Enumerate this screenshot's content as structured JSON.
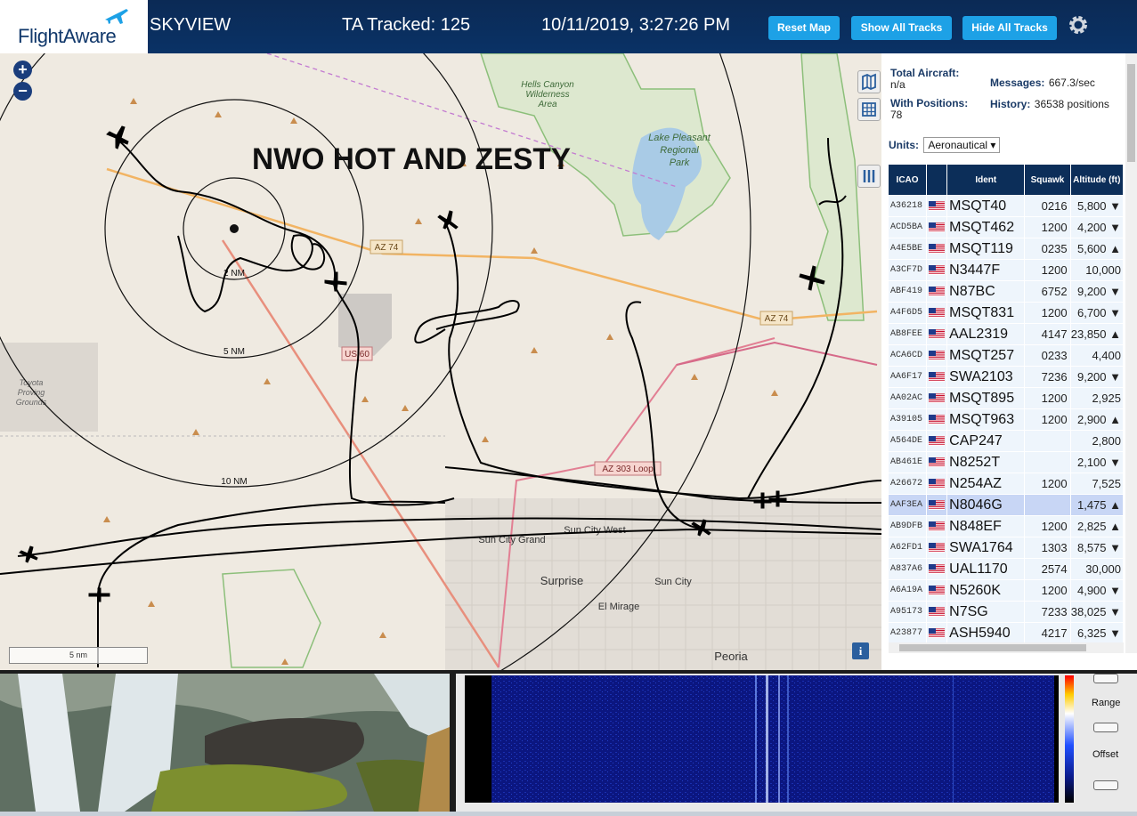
{
  "header": {
    "logo_text": "FlightAware",
    "app_name": "SKYVIEW",
    "tracked": "TA Tracked: 125",
    "datetime": "10/11/2019, 3:27:26 PM",
    "buttons": {
      "reset": "Reset Map",
      "show_all": "Show All Tracks",
      "hide_all": "Hide All Tracks"
    }
  },
  "map": {
    "overlay_text": "NWO HOT AND ZESTY",
    "range_rings": [
      "2 NM",
      "5 NM",
      "10 NM"
    ],
    "scale_label": "5 nm",
    "places": [
      "Hells Canyon Wilderness Area",
      "Lake Pleasant Regional Park",
      "Toyota Proving Grounds",
      "Sun City Grand",
      "Sun City West",
      "Surprise",
      "Sun City",
      "El Mirage",
      "Peoria"
    ],
    "roads": [
      "AZ 74",
      "AZ 74",
      "US 60",
      "AZ 303 Loop"
    ]
  },
  "stats": {
    "total_aircraft_label": "Total Aircraft:",
    "total_aircraft_value": "n/a",
    "with_positions_label": "With Positions:",
    "with_positions_value": "78",
    "messages_label": "Messages:",
    "messages_value": "667.3/sec",
    "history_label": "History:",
    "history_value": "36538 positions",
    "units_label": "Units:",
    "units_value": "Aeronautical"
  },
  "table": {
    "headers": [
      "ICAO",
      "",
      "Ident",
      "Squawk",
      "Altitude (ft)"
    ],
    "rows": [
      {
        "icao": "A36218",
        "ident": "MSQT40",
        "squawk": "0216",
        "alt": "5,800 ▼"
      },
      {
        "icao": "ACD5BA",
        "ident": "MSQT462",
        "squawk": "1200",
        "alt": "4,200 ▼"
      },
      {
        "icao": "A4E5BE",
        "ident": "MSQT119",
        "squawk": "0235",
        "alt": "5,600 ▲"
      },
      {
        "icao": "A3CF7D",
        "ident": "N3447F",
        "squawk": "1200",
        "alt": "10,000"
      },
      {
        "icao": "ABF419",
        "ident": "N87BC",
        "squawk": "6752",
        "alt": "9,200 ▼"
      },
      {
        "icao": "A4F6D5",
        "ident": "MSQT831",
        "squawk": "1200",
        "alt": "6,700 ▼"
      },
      {
        "icao": "AB8FEE",
        "ident": "AAL2319",
        "squawk": "4147",
        "alt": "23,850 ▲"
      },
      {
        "icao": "ACA6CD",
        "ident": "MSQT257",
        "squawk": "0233",
        "alt": "4,400"
      },
      {
        "icao": "AA6F17",
        "ident": "SWA2103",
        "squawk": "7236",
        "alt": "9,200 ▼"
      },
      {
        "icao": "AA02AC",
        "ident": "MSQT895",
        "squawk": "1200",
        "alt": "2,925"
      },
      {
        "icao": "A39105",
        "ident": "MSQT963",
        "squawk": "1200",
        "alt": "2,900 ▲"
      },
      {
        "icao": "A564DE",
        "ident": "CAP247",
        "squawk": "",
        "alt": "2,800"
      },
      {
        "icao": "AB461E",
        "ident": "N8252T",
        "squawk": "",
        "alt": "2,100 ▼"
      },
      {
        "icao": "A26672",
        "ident": "N254AZ",
        "squawk": "1200",
        "alt": "7,525"
      },
      {
        "icao": "AAF3EA",
        "ident": "N8046G",
        "squawk": "",
        "alt": "1,475 ▲",
        "selected": true
      },
      {
        "icao": "AB9DFB",
        "ident": "N848EF",
        "squawk": "1200",
        "alt": "2,825 ▲"
      },
      {
        "icao": "A62FD1",
        "ident": "SWA1764",
        "squawk": "1303",
        "alt": "8,575 ▼"
      },
      {
        "icao": "A837A6",
        "ident": "UAL1170",
        "squawk": "2574",
        "alt": "30,000"
      },
      {
        "icao": "A6A19A",
        "ident": "N5260K",
        "squawk": "1200",
        "alt": "4,900 ▼"
      },
      {
        "icao": "A95173",
        "ident": "N7SG",
        "squawk": "7233",
        "alt": "38,025 ▼"
      },
      {
        "icao": "A23877",
        "ident": "ASH5940",
        "squawk": "4217",
        "alt": "6,325 ▼"
      }
    ]
  },
  "spectrum": {
    "range_label": "Range",
    "offset_label": "Offset"
  },
  "colors": {
    "header_bg": "#0a3266",
    "button_bg": "#1da1e6",
    "table_header_bg": "#0c2e59",
    "selected_row": "#c8d6f5"
  },
  "icons": [
    "plane-logo-icon",
    "gear-icon",
    "zoom-in-icon",
    "zoom-out-icon",
    "map-icon",
    "grid-icon",
    "columns-icon",
    "info-icon",
    "us-flag-icon"
  ]
}
